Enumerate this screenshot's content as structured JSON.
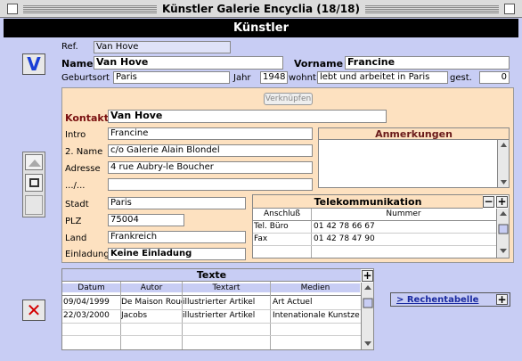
{
  "window": {
    "title": "Künstler Galerie Encyclia (18/18)"
  },
  "header": {
    "title": "Künstler"
  },
  "top": {
    "ref_label": "Ref.",
    "ref_value": "Van Hove",
    "name_label": "Name",
    "name_value": "Van Hove",
    "vorname_label": "Vorname",
    "vorname_value": "Francine",
    "geburtsort_label": "Geburtsort",
    "geburtsort_value": "Paris",
    "jahr_label": "Jahr",
    "jahr_value": "1948",
    "wohnt_label": "wohnt",
    "wohnt_value": "lebt und arbeitet in Paris",
    "gest_label": "gest.",
    "gest_value": "0"
  },
  "contact": {
    "verknuepfen_label": "Verknüpfen",
    "kontakt_label": "Kontakt",
    "kontakt_value": "Van Hove",
    "intro_label": "Intro",
    "intro_value": "Francine",
    "name2_label": "2. Name",
    "name2_value": "c/o Galerie Alain Blondel",
    "adresse_label": "Adresse",
    "adresse_value": "4 rue Aubry-le Boucher",
    "co_label": ".../...",
    "co_value": "",
    "stadt_label": "Stadt",
    "stadt_value": "Paris",
    "plz_label": "PLZ",
    "plz_value": "75004",
    "land_label": "Land",
    "land_value": "Frankreich",
    "einladung_label": "Einladung",
    "einladung_value": "Keine Einladung"
  },
  "anmerkungen": {
    "title": "Anmerkungen"
  },
  "telekom": {
    "title": "Telekommunikation",
    "col_anschluss": "Anschluß",
    "col_nummer": "Nummer",
    "rows": [
      {
        "anschluss": "Tel. Büro",
        "nummer": "01 42 78 66 67"
      },
      {
        "anschluss": "Fax",
        "nummer": "01 42 78 47 90"
      }
    ]
  },
  "texte": {
    "title": "Texte",
    "columns": [
      "Datum",
      "Autor",
      "Textart",
      "Medien"
    ],
    "rows": [
      [
        "09/04/1999",
        "De Maison Roug",
        "illustrierter Artikel",
        "Art Actuel"
      ],
      [
        "22/03/2000",
        "Jacobs",
        "illustrierter Artikel",
        "Intenationale Kunstzei"
      ]
    ]
  },
  "rechentabelle": {
    "label": "> Rechentabelle"
  },
  "buttons": {
    "v_label": "V",
    "x_label": "✕",
    "plus": "+",
    "minus": "−"
  }
}
